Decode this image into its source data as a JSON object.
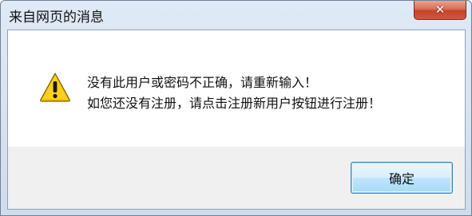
{
  "dialog": {
    "title": "来自网页的消息",
    "icon": "warning-icon",
    "close_icon": "close-icon",
    "message_lines": [
      "没有此用户或密码不正确，请重新输入！",
      "如您还没有注册，请点击注册新用户按钮进行注册！"
    ],
    "ok_label": "确定"
  },
  "colors": {
    "title_bar": "#dfeaf6",
    "close_button": "#c4432a",
    "client_bg": "#f0f0f0",
    "ok_button_border": "#3c7fb1",
    "warning_yellow": "#f5c400"
  }
}
